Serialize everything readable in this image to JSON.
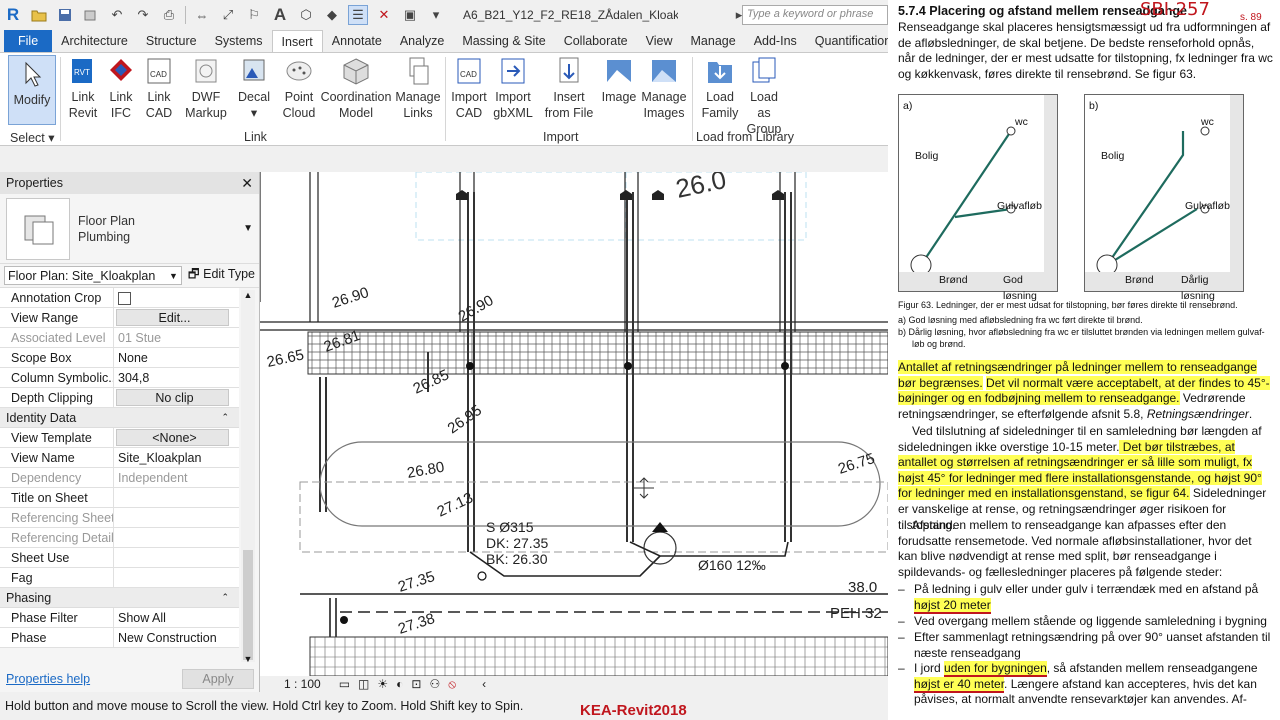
{
  "app": {
    "doc_title": "A6_B21_Y12_F2_RE18_ZÅdalen_Kloak...",
    "search_placeholder": "Type a keyword or phrase",
    "logo": "R"
  },
  "tabs": [
    "File",
    "Architecture",
    "Structure",
    "Systems",
    "Insert",
    "Annotate",
    "Analyze",
    "Massing & Site",
    "Collaborate",
    "View",
    "Manage",
    "Add-Ins",
    "Quantification"
  ],
  "active_tab": "Insert",
  "ribbon": {
    "modify": "Modify",
    "select_label": "Select",
    "link_buttons": [
      {
        "l1": "Link",
        "l2": "Revit",
        "icon": "link-revit-icon"
      },
      {
        "l1": "Link",
        "l2": "IFC",
        "icon": "link-ifc-icon"
      },
      {
        "l1": "Link",
        "l2": "CAD",
        "icon": "link-cad-icon"
      },
      {
        "l1": "DWF",
        "l2": "Markup",
        "icon": "dwf-markup-icon"
      },
      {
        "l1": "Decal",
        "l2": "",
        "icon": "decal-icon"
      },
      {
        "l1": "Point",
        "l2": "Cloud",
        "icon": "point-cloud-icon"
      },
      {
        "l1": "Coordination",
        "l2": "Model",
        "icon": "coordination-model-icon"
      },
      {
        "l1": "Manage",
        "l2": "Links",
        "icon": "manage-links-icon"
      }
    ],
    "link_panel": "Link",
    "import_buttons": [
      {
        "l1": "Import",
        "l2": "CAD",
        "icon": "import-cad-icon"
      },
      {
        "l1": "Import",
        "l2": "gbXML",
        "icon": "import-gbxml-icon"
      },
      {
        "l1": "Insert",
        "l2": "from File",
        "icon": "insert-from-file-icon"
      },
      {
        "l1": "Image",
        "l2": "",
        "icon": "image-icon"
      },
      {
        "l1": "Manage",
        "l2": "Images",
        "icon": "manage-images-icon"
      }
    ],
    "import_panel": "Import",
    "library_buttons": [
      {
        "l1": "Load",
        "l2": "Family",
        "icon": "load-family-icon"
      },
      {
        "l1": "Load as",
        "l2": "Group",
        "icon": "load-as-group-icon"
      }
    ],
    "library_panel": "Load from Library"
  },
  "properties": {
    "title": "Properties",
    "type_name_1": "Floor Plan",
    "type_name_2": "Plumbing",
    "instance_filter": "Floor Plan: Site_Kloakplan",
    "edit_type": "Edit Type",
    "rows_graphics": [
      {
        "k": "Annotation Crop",
        "v": "",
        "kind": "checkbox"
      },
      {
        "k": "View Range",
        "v": "Edit...",
        "kind": "button"
      },
      {
        "k": "Associated Level",
        "v": "01 Stue",
        "kind": "dim"
      },
      {
        "k": "Scope Box",
        "v": "None",
        "kind": "text"
      },
      {
        "k": "Column Symbolic...",
        "v": "304,8",
        "kind": "text"
      },
      {
        "k": "Depth Clipping",
        "v": "No clip",
        "kind": "button"
      }
    ],
    "group_identity": "Identity Data",
    "rows_identity": [
      {
        "k": "View Template",
        "v": "<None>",
        "kind": "button"
      },
      {
        "k": "View Name",
        "v": "Site_Kloakplan",
        "kind": "text"
      },
      {
        "k": "Dependency",
        "v": "Independent",
        "kind": "dim"
      },
      {
        "k": "Title on Sheet",
        "v": "",
        "kind": "text"
      },
      {
        "k": "Referencing Sheet",
        "v": "",
        "kind": "dim"
      },
      {
        "k": "Referencing Detail",
        "v": "",
        "kind": "dim"
      },
      {
        "k": "Sheet Use",
        "v": "",
        "kind": "text"
      },
      {
        "k": "Fag",
        "v": "",
        "kind": "text"
      }
    ],
    "group_phasing": "Phasing",
    "rows_phasing": [
      {
        "k": "Phase Filter",
        "v": "Show All",
        "kind": "text"
      },
      {
        "k": "Phase",
        "v": "New Construction",
        "kind": "text"
      }
    ],
    "help": "Properties help",
    "apply": "Apply"
  },
  "canvas": {
    "scale": "1 : 100",
    "labels": [
      "26.90",
      "26.90",
      "26.65",
      "26.81",
      "26.85",
      "26.95",
      "26.80",
      "27.13",
      "26.75",
      "27.35",
      "27.38",
      "38.0",
      "PEH 32"
    ],
    "pipe_tag": "S Ø315",
    "dk": "DK: 27.35",
    "bk": "BK: 26.30",
    "slope": "Ø160 12‰",
    "big_text": "26.0"
  },
  "status": "Hold button and move mouse to Scroll the view. Hold Ctrl key to Zoom. Hold Shift key to Spin.",
  "watermark": "KEA-Revit2018",
  "doc": {
    "handwriting": "SBI-257",
    "handwriting_small": "s. 89",
    "heading": "5.7.4 Placering og afstand mellem renseadgange",
    "intro": "Renseadgange skal placeres hensigtsmæssigt ud fra udformningen af de afløbsledninger, de skal betjene. De bedste renseforhold opnås, når de ledninger, der er mest udsatte for tilstopning, fx ledninger fra wc og køkkenvask, føres direkte til rensebrønd. Se figur 63.",
    "fig_a": {
      "tag": "a)",
      "wc": "wc",
      "bolig": "Bolig",
      "gulv": "Gulvafløb",
      "brond": "Brønd",
      "caption": "God løsning"
    },
    "fig_b": {
      "tag": "b)",
      "wc": "wc",
      "bolig": "Bolig",
      "gulv": "Gulvafløb",
      "brond": "Brønd",
      "caption": "Dårlig løsning"
    },
    "fig_caption": "Figur 63. Ledninger, der er mest udsat for tilstopning, bør føres direkte til rensebrønd.",
    "fig_item_a": "a)  God løsning med afløbsledning fra wc ført direkte til brønd.",
    "fig_item_b1": "b)  Dårlig løsning, hvor afløbsledning fra wc er tilsluttet brønden via ledningen mellem gulvaf-",
    "fig_item_b2": "løb og brønd.",
    "para1_hl": "Antallet af retningsændringer på ledninger mellem to renseadgange bør begrænses.",
    "para1_plain": " ",
    "para1_hl2": "Det vil normalt være acceptabelt, at der findes to 45°-bøjninger og en fodbøjning mellem to renseadgange.",
    "para1_tail": " Vedrørende retningsændringer, se efterfølgende afsnit 5.8, ",
    "para1_italic": "Retningsændringer",
    "para2_plain": "Ved tilslutning af sideledninger til en samleledning bør længden af sideledningen ikke overstige 10-15 meter.",
    "para2_hl": " Det bør tilstræbes, at antallet og størrelsen af retningsændringer er så lille som muligt, fx højst 45° for ledninger med flere installationsgenstande, og højst 90° for ledninger med en installationsgenstand, se figur 64.",
    "para2_tail": " Sideledninger er vanskelige at rense, og retningsændringer øger risikoen for tilstopning.",
    "para3": "Afstanden mellem to renseadgange kan afpasses efter den forudsatte rensemetode. Ved normale afløbsinstallationer, hvor det kan blive nødvendigt at rense med split, bør renseadgange i spildevands- og fællesledninger placeres på følgende steder:",
    "b1_plain": "På ledning i gulv eller under gulv i terrændæk med en afstand på",
    "b1_hl": "højst 20 meter",
    "b2": "Ved overgang mellem stående og liggende samleledning i bygning",
    "b3": "Efter sammenlagt retningsændring på over 90° uanset afstanden til næste renseadgang",
    "b4_plain": "I jord ",
    "b4_hl": "uden for bygningen",
    "b4_mid": ", så afstanden mellem renseadgangene",
    "b4_hl2": "højst er 40 meter",
    "b4_tail": ". Længere afstand kan accepteres, hvis det kan påvises, at normalt anvendte rensevarktøjer kan anvendes. Af-"
  }
}
